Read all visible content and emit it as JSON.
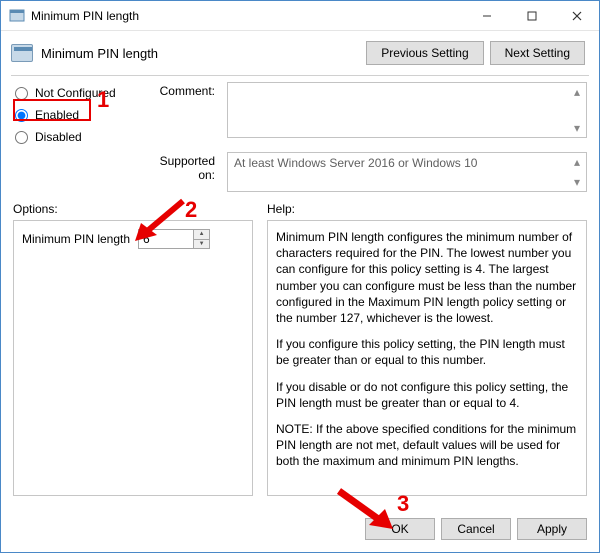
{
  "window": {
    "title": "Minimum PIN length"
  },
  "subheader": {
    "title": "Minimum PIN length",
    "prev": "Previous Setting",
    "next": "Next Setting"
  },
  "radios": {
    "notconf": "Not Configured",
    "enabled": "Enabled",
    "disabled": "Disabled"
  },
  "labels": {
    "comment": "Comment:",
    "supported": "Supported on:",
    "options": "Options:",
    "help": "Help:"
  },
  "supported_text": "At least Windows Server 2016 or Windows 10",
  "option": {
    "label": "Minimum PIN length",
    "value": "6"
  },
  "help": {
    "p1": "Minimum PIN length configures the minimum number of characters required for the PIN.  The lowest number you can configure for this policy setting is 4.  The largest number you can configure must be less than the number configured in the Maximum PIN length policy setting or the number 127, whichever is the lowest.",
    "p2": "If you configure this policy setting, the PIN length must be greater than or equal to this number.",
    "p3": "If you disable or do not configure this policy setting, the PIN length must be greater than or equal to 4.",
    "p4": "NOTE: If the above specified conditions for the minimum PIN length are not met, default values will be used for both the maximum and minimum PIN lengths."
  },
  "buttons": {
    "ok": "OK",
    "cancel": "Cancel",
    "apply": "Apply"
  },
  "anno": {
    "n1": "1",
    "n2": "2",
    "n3": "3"
  }
}
